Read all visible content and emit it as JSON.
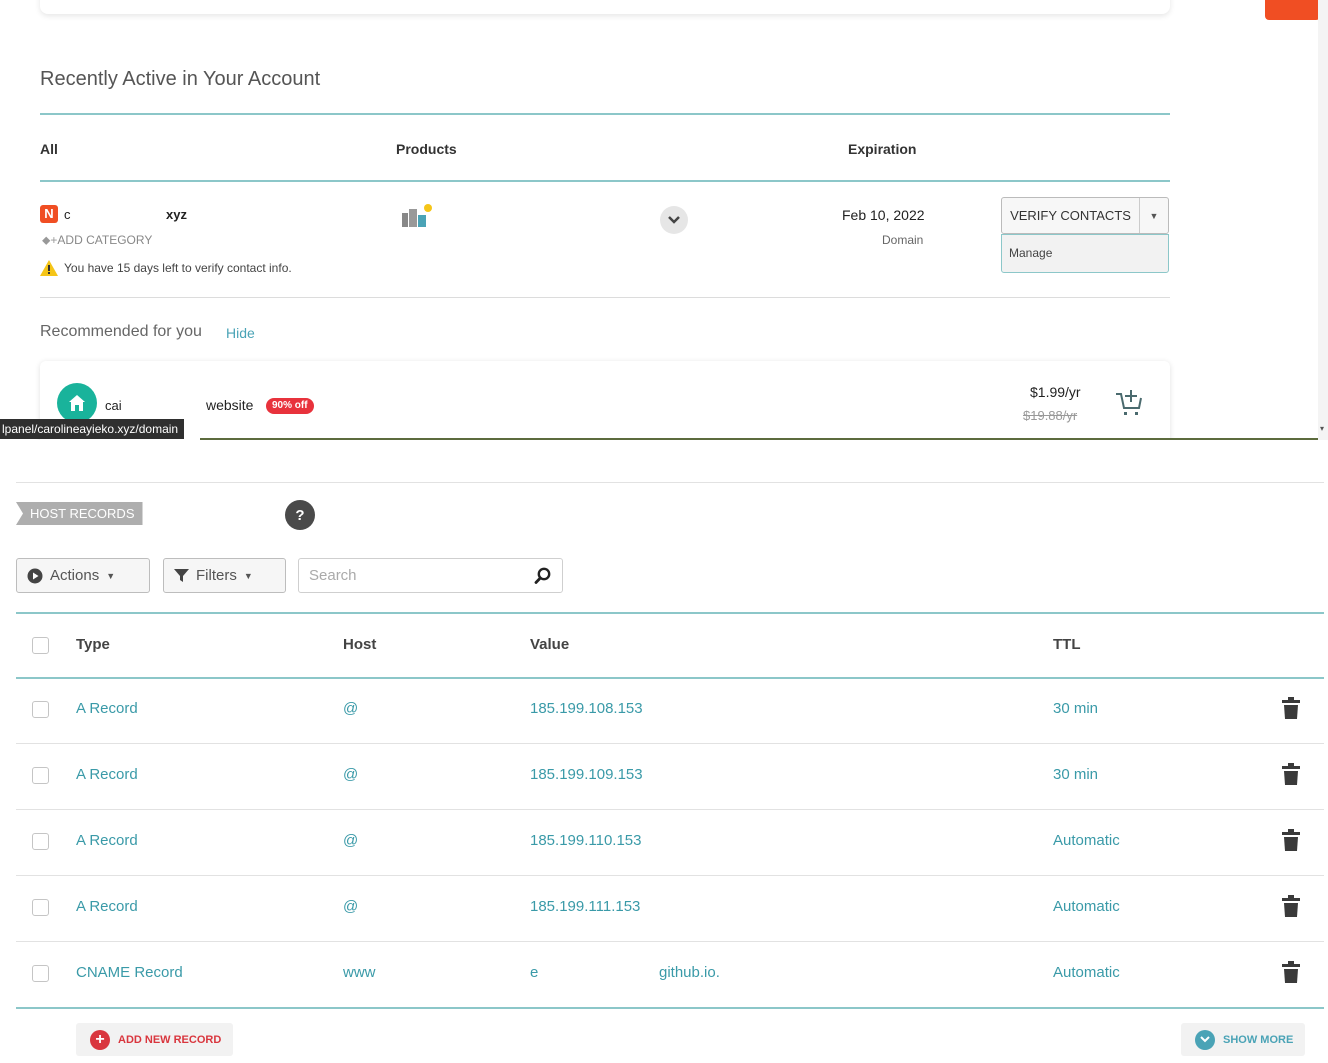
{
  "account": {
    "title": "Recently Active in Your Account",
    "columns": {
      "all": "All",
      "products": "Products",
      "expiration": "Expiration"
    },
    "domain": {
      "name_start": "c",
      "name_end": "xyz",
      "add_category": "ADD CATEGORY",
      "warning": "You have 15 days left to verify contact info.",
      "expiration_date": "Feb 10, 2022",
      "expiration_type": "Domain",
      "verify_label": "VERIFY CONTACTS",
      "menu_manage": "Manage"
    },
    "recommended": {
      "title": "Recommended for you",
      "hide_label": "Hide",
      "name_start": "cai",
      "name_end": "website",
      "badge": "90% off",
      "price": "$1.99/yr",
      "old_price": "$19.88/yr"
    },
    "status_url": "lpanel/carolineayieko.xyz/domain"
  },
  "host_records": {
    "tag": "HOST RECORDS",
    "help": "?",
    "actions_label": "Actions",
    "filters_label": "Filters",
    "search_placeholder": "Search",
    "headers": {
      "type": "Type",
      "host": "Host",
      "value": "Value",
      "ttl": "TTL"
    },
    "rows": [
      {
        "type": "A Record",
        "host": "@",
        "value": "185.199.108.153",
        "ttl": "30 min"
      },
      {
        "type": "A Record",
        "host": "@",
        "value": "185.199.109.153",
        "ttl": "30 min"
      },
      {
        "type": "A Record",
        "host": "@",
        "value": "185.199.110.153",
        "ttl": "Automatic"
      },
      {
        "type": "A Record",
        "host": "@",
        "value": "185.199.111.153",
        "ttl": "Automatic"
      },
      {
        "type": "CNAME Record",
        "host": "www",
        "value_start": "e",
        "value_end": "github.io.",
        "ttl": "Automatic"
      }
    ],
    "add_label": "ADD NEW RECORD",
    "show_more_label": "SHOW MORE"
  },
  "colors": {
    "accent_teal": "#4aa3b6",
    "brand_orange": "#f04e23",
    "danger_red": "#d9363e"
  }
}
